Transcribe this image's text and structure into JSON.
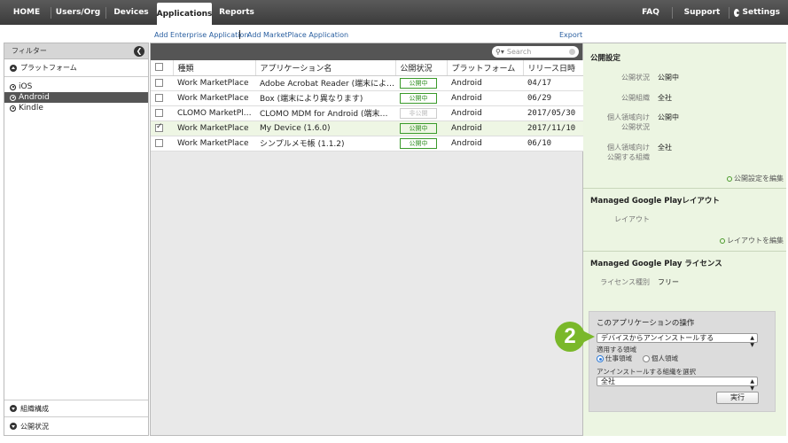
{
  "topnav": {
    "tabs": [
      "HOME",
      "Users/Org",
      "Devices",
      "Applications",
      "Reports"
    ],
    "right": [
      "FAQ",
      "Support",
      "Settings"
    ]
  },
  "links": {
    "add_enterprise": "Add Enterprise Application",
    "separator": "|",
    "add_marketplace": "Add MarketPlace Application",
    "export": "Export"
  },
  "filter": {
    "title": "フィルター",
    "platform_header": "プラットフォーム",
    "platforms": [
      "iOS",
      "Android",
      "Kindle"
    ],
    "selected": "Android",
    "org_header": "組織構成",
    "status_header": "公開状況"
  },
  "search": {
    "placeholder": "Search"
  },
  "table": {
    "columns": [
      "種類",
      "アプリケーション名",
      "公開状況",
      "プラットフォーム",
      "リリース日時"
    ],
    "rows": [
      {
        "checked": false,
        "kind": "Work MarketPlace",
        "name": "Adobe Acrobat Reader (端末により...",
        "status": "公開中",
        "platform": "Android",
        "date": "04/17"
      },
      {
        "checked": false,
        "kind": "Work MarketPlace",
        "name": "Box (端末により異なります)",
        "status": "公開中",
        "platform": "Android",
        "date": "06/29"
      },
      {
        "checked": false,
        "kind": "CLOMO MarketPlace",
        "name": "CLOMO MDM for Android (端末によ...",
        "status": "非公開",
        "platform": "Android",
        "date": "2017/05/30"
      },
      {
        "checked": true,
        "kind": "Work MarketPlace",
        "name": "My Device (1.6.0)",
        "status": "公開中",
        "platform": "Android",
        "date": "2017/11/10"
      },
      {
        "checked": false,
        "kind": "Work MarketPlace",
        "name": "シンプルメモ帳 (1.1.2)",
        "status": "公開中",
        "platform": "Android",
        "date": "06/10"
      }
    ]
  },
  "right": {
    "publish_title": "公開設定",
    "status_label": "公開状況",
    "status_value": "公開中",
    "org_label": "公開組織",
    "org_value": "全社",
    "personal_status_label": "個人領域向け\n公開状況",
    "personal_status_value": "公開中",
    "personal_org_label": "個人領域向け\n公開する組織",
    "personal_org_value": "全社",
    "edit_publish": "公開設定を編集",
    "layout_title": "Managed Google Playレイアウト",
    "layout_label": "レイアウト",
    "edit_layout": "レイアウトを編集",
    "license_title": "Managed Google Play ライセンス",
    "license_label": "ライセンス種別",
    "license_value": "フリー"
  },
  "ops": {
    "title": "このアプリケーションの操作",
    "action": "デバイスからアンインストールする",
    "scope_label": "適用する領域",
    "scope_work": "仕事領域",
    "scope_personal": "個人領域",
    "org_label": "アンインストールする組織を選択",
    "org_value": "全社",
    "exec": "実行"
  },
  "callout": "2",
  "colors": {
    "accent_green": "#7ab82a",
    "nav_dark": "#444444",
    "link_blue": "#2a5fa0"
  }
}
